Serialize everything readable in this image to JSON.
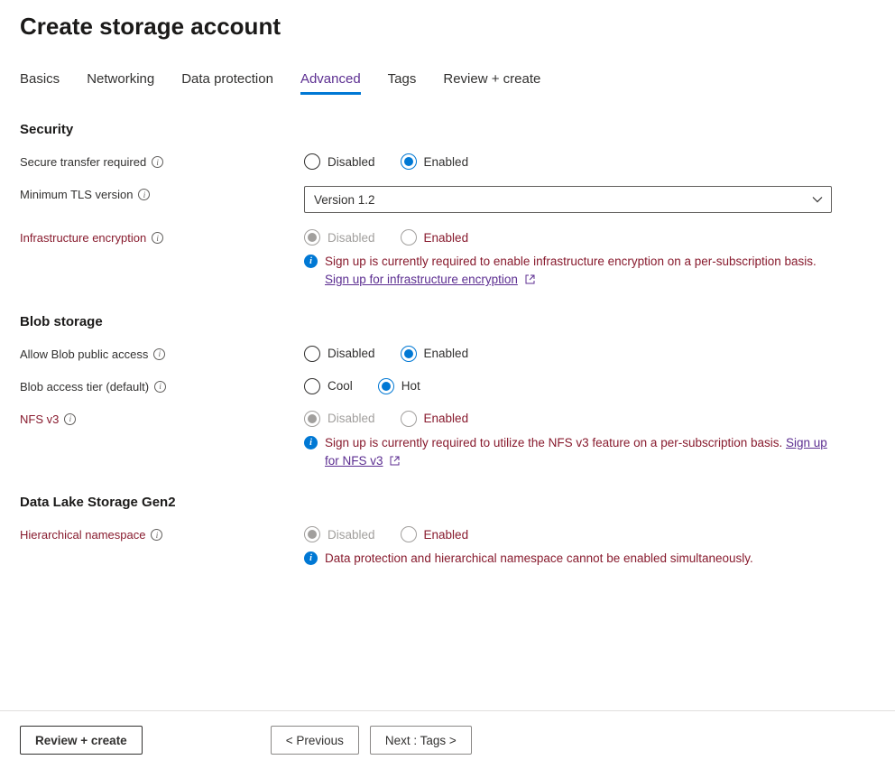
{
  "page_title": "Create storage account",
  "tabs": [
    {
      "label": "Basics",
      "active": false
    },
    {
      "label": "Networking",
      "active": false
    },
    {
      "label": "Data protection",
      "active": false
    },
    {
      "label": "Advanced",
      "active": true
    },
    {
      "label": "Tags",
      "active": false
    },
    {
      "label": "Review + create",
      "active": false
    }
  ],
  "sections": {
    "security": {
      "header": "Security",
      "secure_transfer": {
        "label": "Secure transfer required",
        "disabled_label": "Disabled",
        "enabled_label": "Enabled",
        "value": "Enabled"
      },
      "min_tls": {
        "label": "Minimum TLS version",
        "selected": "Version 1.2"
      },
      "infra_encryption": {
        "label": "Infrastructure encryption",
        "disabled_label": "Disabled",
        "enabled_label": "Enabled",
        "value": "Disabled",
        "locked": true,
        "info_text_pre": "Sign up is currently required to enable infrastructure encryption on a per-subscription basis. ",
        "info_link_text": "Sign up for infrastructure encryption"
      }
    },
    "blob": {
      "header": "Blob storage",
      "public_access": {
        "label": "Allow Blob public access",
        "disabled_label": "Disabled",
        "enabled_label": "Enabled",
        "value": "Enabled"
      },
      "access_tier": {
        "label": "Blob access tier (default)",
        "cool_label": "Cool",
        "hot_label": "Hot",
        "value": "Hot"
      },
      "nfs": {
        "label": "NFS v3",
        "disabled_label": "Disabled",
        "enabled_label": "Enabled",
        "value": "Disabled",
        "locked": true,
        "info_text_pre": "Sign up is currently required to utilize the NFS v3 feature on a per-subscription basis. ",
        "info_link_text": "Sign up for NFS v3"
      }
    },
    "datalake": {
      "header": "Data Lake Storage Gen2",
      "hns": {
        "label": "Hierarchical namespace",
        "disabled_label": "Disabled",
        "enabled_label": "Enabled",
        "value": "Disabled",
        "locked": true,
        "info_text": "Data protection and hierarchical namespace cannot be enabled simultaneously."
      }
    }
  },
  "footer": {
    "review": "Review + create",
    "previous": "< Previous",
    "next": "Next : Tags >"
  }
}
